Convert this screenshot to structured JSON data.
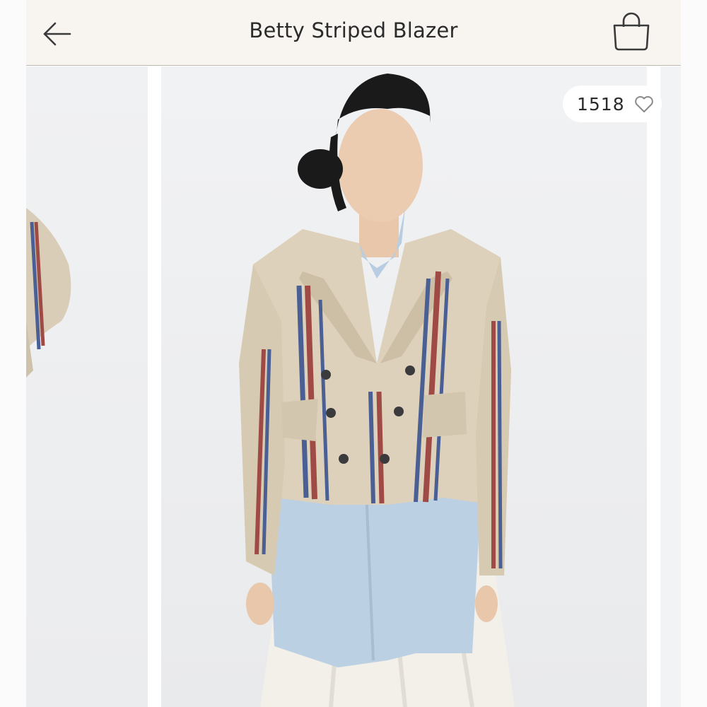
{
  "header": {
    "title": "Betty Striped Blazer",
    "back_icon": "arrow-left-icon",
    "bag_icon": "shopping-bag-icon"
  },
  "product": {
    "likes_count": "1518",
    "like_icon": "heart-outline-icon"
  },
  "gallery": {
    "images": [
      "previous-product-photo",
      "model-wearing-striped-blazer-photo",
      "next-product-photo"
    ]
  },
  "colors": {
    "header_bg": "#f8f5f1",
    "text": "#2b2b2b",
    "image_bg": "#eeeff1"
  }
}
